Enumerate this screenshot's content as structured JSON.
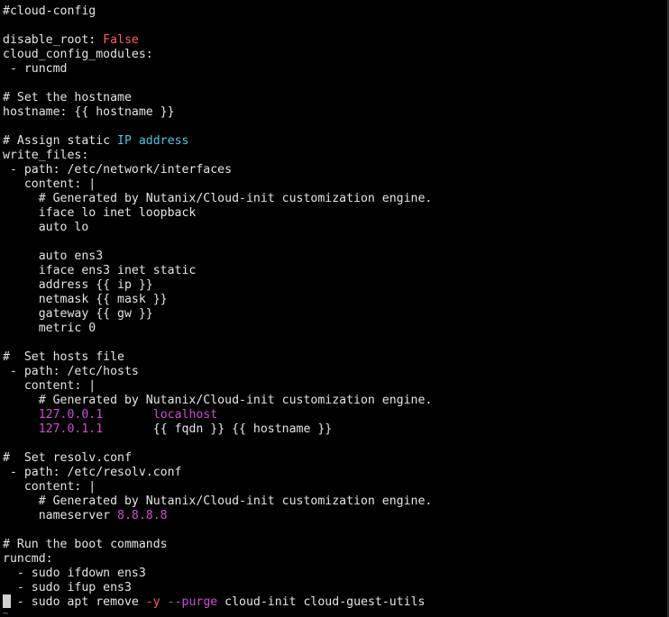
{
  "editor": {
    "lines": [
      [
        {
          "t": "#cloud-config",
          "c": "plain"
        }
      ],
      [],
      [
        {
          "t": "disable_root: ",
          "c": "plain"
        },
        {
          "t": "False",
          "c": "bool"
        }
      ],
      [
        {
          "t": "cloud_config_modules:",
          "c": "plain"
        }
      ],
      [
        {
          "t": " - runcmd",
          "c": "plain"
        }
      ],
      [],
      [
        {
          "t": "# Set the hostname",
          "c": "plain"
        }
      ],
      [
        {
          "t": "hostname: {{ hostname }}",
          "c": "plain"
        }
      ],
      [],
      [
        {
          "t": "# Assign static ",
          "c": "plain"
        },
        {
          "t": "IP address",
          "c": "keyword"
        }
      ],
      [
        {
          "t": "write_files:",
          "c": "plain"
        }
      ],
      [
        {
          "t": " - path: /etc/network/interfaces",
          "c": "plain"
        }
      ],
      [
        {
          "t": "   content: |",
          "c": "plain"
        }
      ],
      [
        {
          "t": "     # Generated by Nutanix/Cloud-init customization engine.",
          "c": "plain"
        }
      ],
      [
        {
          "t": "     iface lo inet loopback",
          "c": "plain"
        }
      ],
      [
        {
          "t": "     auto lo",
          "c": "plain"
        }
      ],
      [],
      [
        {
          "t": "     auto ens3",
          "c": "plain"
        }
      ],
      [
        {
          "t": "     iface ens3 inet static",
          "c": "plain"
        }
      ],
      [
        {
          "t": "     address {{ ip }}",
          "c": "plain"
        }
      ],
      [
        {
          "t": "     netmask {{ mask }}",
          "c": "plain"
        }
      ],
      [
        {
          "t": "     gateway {{ gw }}",
          "c": "plain"
        }
      ],
      [
        {
          "t": "     metric 0",
          "c": "plain"
        }
      ],
      [],
      [
        {
          "t": "#  Set hosts file",
          "c": "plain"
        }
      ],
      [
        {
          "t": " - path: /etc/hosts",
          "c": "plain"
        }
      ],
      [
        {
          "t": "   content: |",
          "c": "plain"
        }
      ],
      [
        {
          "t": "     # Generated by Nutanix/Cloud-init customization engine.",
          "c": "plain"
        }
      ],
      [
        {
          "t": "     ",
          "c": "plain"
        },
        {
          "t": "127.0.0.1",
          "c": "ip"
        },
        {
          "t": "       ",
          "c": "plain"
        },
        {
          "t": "localhost",
          "c": "ip"
        }
      ],
      [
        {
          "t": "     ",
          "c": "plain"
        },
        {
          "t": "127.0.1.1",
          "c": "ip"
        },
        {
          "t": "       {{ fqdn }} {{ hostname }}",
          "c": "plain"
        }
      ],
      [],
      [
        {
          "t": "#  Set resolv.conf",
          "c": "plain"
        }
      ],
      [
        {
          "t": " - path: /etc/resolv.conf",
          "c": "plain"
        }
      ],
      [
        {
          "t": "   content: |",
          "c": "plain"
        }
      ],
      [
        {
          "t": "     # Generated by Nutanix/Cloud-init customization engine.",
          "c": "plain"
        }
      ],
      [
        {
          "t": "     nameserver ",
          "c": "plain"
        },
        {
          "t": "8.8.8.8",
          "c": "num"
        }
      ],
      [],
      [
        {
          "t": "# Run the boot commands",
          "c": "plain"
        }
      ],
      [
        {
          "t": "runcmd:",
          "c": "plain"
        }
      ],
      [
        {
          "t": "  - sudo ifdown ens3",
          "c": "plain"
        }
      ],
      [
        {
          "t": "  - sudo ifup ens3",
          "c": "plain"
        }
      ],
      [
        {
          "t": "  - sudo apt remove ",
          "c": "plain"
        },
        {
          "t": "-y",
          "c": "flag"
        },
        {
          "t": " ",
          "c": "plain"
        },
        {
          "t": "--purge",
          "c": "opt"
        },
        {
          "t": " cloud-init cloud-guest-utils",
          "c": "plain"
        }
      ]
    ]
  },
  "colors": {
    "background": "#000000",
    "text": "#e4e4e4",
    "boolean": "#ff5f5f",
    "keyword": "#4fc3e8",
    "ip_address": "#d14bd1",
    "flag": "#ff5f5f",
    "option": "#d14bd1",
    "cursor": "#d0d0d0",
    "tilde": "#3a8ad6"
  },
  "cursor": {
    "icon": "block-cursor-icon"
  },
  "end_of_buffer": {
    "icon": "tilde-marker-icon",
    "glyph": "~"
  }
}
